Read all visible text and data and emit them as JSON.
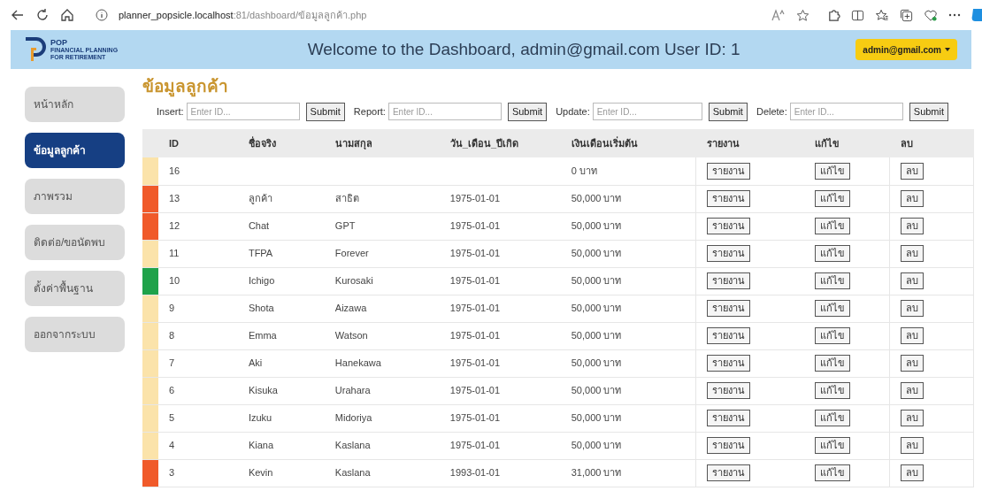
{
  "browser": {
    "host": "planner_popsicle.localhost",
    "path": ":81/dashboard/ข้อมูลลูกค้า.php"
  },
  "header": {
    "logo": {
      "name": "POP",
      "line_1": "FINANCIAL PLANNING",
      "line_2": "FOR RETIREMENT"
    },
    "title": "Welcome to the Dashboard, admin@gmail.com User ID: 1",
    "user_menu": "admin@gmail.com"
  },
  "sidebar": {
    "items": [
      {
        "label": "หน้าหลัก",
        "selected": false
      },
      {
        "label": "ข้อมูลลูกค้า",
        "selected": true
      },
      {
        "label": "ภาพรวม",
        "selected": false
      },
      {
        "label": "ติดต่อ/ขอนัดพบ",
        "selected": false
      },
      {
        "label": "ตั้งค่าพื้นฐาน",
        "selected": false
      },
      {
        "label": "ออกจากระบบ",
        "selected": false
      }
    ]
  },
  "page_title": "ข้อมูลลูกค้า",
  "forms": [
    {
      "label": "Insert:",
      "placeholder": "Enter ID...",
      "button": "Submit"
    },
    {
      "label": "Report:",
      "placeholder": "Enter ID...",
      "button": "Submit"
    },
    {
      "label": "Update:",
      "placeholder": "Enter ID...",
      "button": "Submit"
    },
    {
      "label": "Delete:",
      "placeholder": "Enter ID...",
      "button": "Submit"
    }
  ],
  "table": {
    "columns": [
      "ID",
      "ชื่อจริง",
      "นามสกุล",
      "วัน_เดือน_ปีเกิด",
      "เงินเดือนเริ่มต้น",
      "รายงาน",
      "แก้ไข",
      "ลบ"
    ],
    "rows": [
      {
        "color": "#fbe3aa",
        "id": "16",
        "salary": "0 บาท",
        "report": "รายงาน",
        "edit": "แก้ไข",
        "delete": "ลบ"
      },
      {
        "color": "#f05a2a",
        "id": "13",
        "first_name": "ลูกค้า",
        "last_name": "สาธิต",
        "birth_date": "1975-01-01",
        "salary": "50,000 บาท",
        "report": "รายงาน",
        "edit": "แก้ไข",
        "delete": "ลบ"
      },
      {
        "color": "#f05a2a",
        "id": "12",
        "first_name": "Chat",
        "last_name": "GPT",
        "birth_date": "1975-01-01",
        "salary": "50,000 บาท",
        "report": "รายงาน",
        "edit": "แก้ไข",
        "delete": "ลบ"
      },
      {
        "color": "#fbe3aa",
        "id": "11",
        "first_name": "TFPA",
        "last_name": "Forever",
        "birth_date": "1975-01-01",
        "salary": "50,000 บาท",
        "report": "รายงาน",
        "edit": "แก้ไข",
        "delete": "ลบ"
      },
      {
        "color": "#1fa24a",
        "id": "10",
        "first_name": "Ichigo",
        "last_name": "Kurosaki",
        "birth_date": "1975-01-01",
        "salary": "50,000 บาท",
        "report": "รายงาน",
        "edit": "แก้ไข",
        "delete": "ลบ"
      },
      {
        "color": "#fbe3aa",
        "id": "9",
        "first_name": "Shota",
        "last_name": "Aizawa",
        "birth_date": "1975-01-01",
        "salary": "50,000 บาท",
        "report": "รายงาน",
        "edit": "แก้ไข",
        "delete": "ลบ"
      },
      {
        "color": "#fbe3aa",
        "id": "8",
        "first_name": "Emma",
        "last_name": "Watson",
        "birth_date": "1975-01-01",
        "salary": "50,000 บาท",
        "report": "รายงาน",
        "edit": "แก้ไข",
        "delete": "ลบ"
      },
      {
        "color": "#fbe3aa",
        "id": "7",
        "first_name": "Aki",
        "last_name": "Hanekawa",
        "birth_date": "1975-01-01",
        "salary": "50,000 บาท",
        "report": "รายงาน",
        "edit": "แก้ไข",
        "delete": "ลบ"
      },
      {
        "color": "#fbe3aa",
        "id": "6",
        "first_name": "Kisuka",
        "last_name": "Urahara",
        "birth_date": "1975-01-01",
        "salary": "50,000 บาท",
        "report": "รายงาน",
        "edit": "แก้ไข",
        "delete": "ลบ"
      },
      {
        "color": "#fbe3aa",
        "id": "5",
        "first_name": "Izuku",
        "last_name": "Midoriya",
        "birth_date": "1975-01-01",
        "salary": "50,000 บาท",
        "report": "รายงาน",
        "edit": "แก้ไข",
        "delete": "ลบ"
      },
      {
        "color": "#fbe3aa",
        "id": "4",
        "first_name": "Kiana",
        "last_name": "Kaslana",
        "birth_date": "1975-01-01",
        "salary": "50,000 บาท",
        "report": "รายงาน",
        "edit": "แก้ไข",
        "delete": "ลบ"
      },
      {
        "color": "#f05a2a",
        "id": "3",
        "first_name": "Kevin",
        "last_name": "Kaslana",
        "birth_date": "1993-01-01",
        "salary": "31,000 บาท",
        "report": "รายงาน",
        "edit": "แก้ไข",
        "delete": "ลบ"
      }
    ]
  }
}
